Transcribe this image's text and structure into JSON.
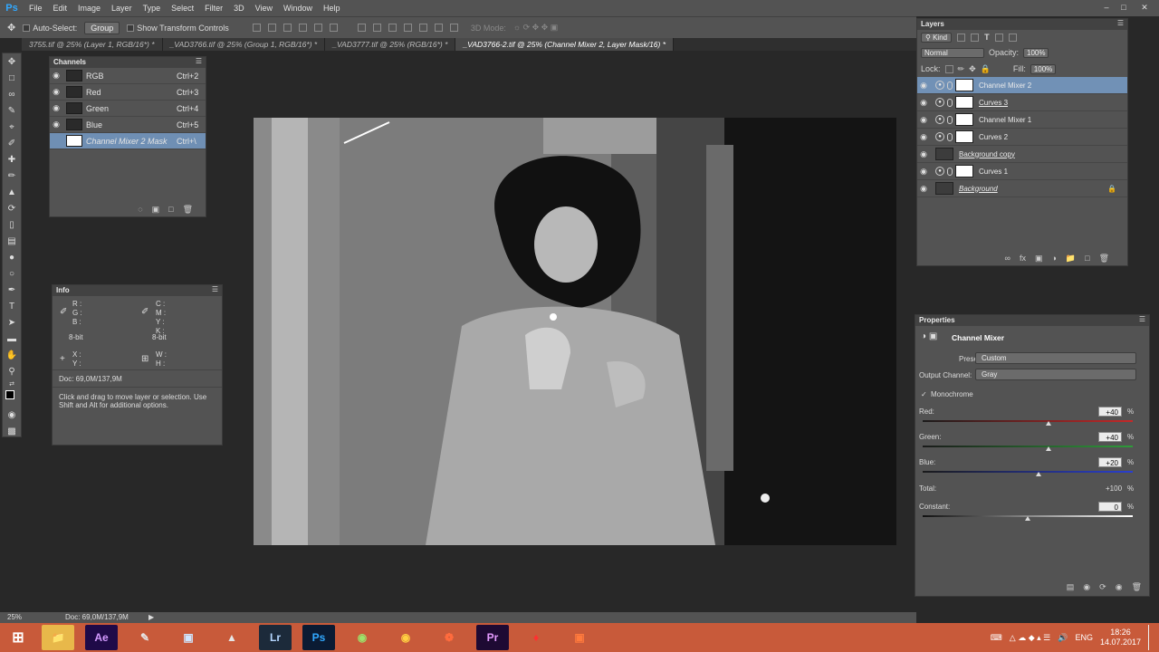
{
  "menubar": {
    "logo": "Ps",
    "items": [
      "File",
      "Edit",
      "Image",
      "Layer",
      "Type",
      "Select",
      "Filter",
      "3D",
      "View",
      "Window",
      "Help"
    ]
  },
  "options": {
    "auto_select_label": "Auto-Select:",
    "auto_select_value": "Group",
    "transform_label": "Show Transform Controls",
    "mode_3d_label": "3D Mode:"
  },
  "tabs": [
    "3755.tif @ 25% (Layer 1, RGB/16*) *",
    "_VAD3766.tif @ 25% (Group 1, RGB/16*) *",
    "_VAD3777.tif @ 25% (RGB/16*) *",
    "_VAD3766-2.tif @ 25% (Channel Mixer 2, Layer Mask/16) *"
  ],
  "channels": {
    "title": "Channels",
    "rows": [
      {
        "name": "RGB",
        "key": "Ctrl+2"
      },
      {
        "name": "Red",
        "key": "Ctrl+3"
      },
      {
        "name": "Green",
        "key": "Ctrl+4"
      },
      {
        "name": "Blue",
        "key": "Ctrl+5"
      },
      {
        "name": "Channel Mixer 2 Mask",
        "key": "Ctrl+\\"
      }
    ]
  },
  "info": {
    "title": "Info",
    "rgb_labels": "R :\nG :\nB :",
    "cmyk_labels": "C :\nM :\nY :\nK :",
    "bit_left": "8-bit",
    "bit_right": "8-bit",
    "xy_labels": "X :\nY :",
    "wh_labels": "W :\nH :",
    "doc": "Doc: 69,0M/137,9M",
    "hint": "Click and drag to move layer or selection.  Use Shift and Alt for additional options."
  },
  "layers": {
    "title": "Layers",
    "kind_label": "Kind",
    "blend_mode": "Normal",
    "opacity_label": "Opacity:",
    "opacity_value": "100%",
    "lock_label": "Lock:",
    "fill_label": "Fill:",
    "fill_value": "100%",
    "rows": [
      {
        "name": "Channel Mixer 2",
        "type": "adjust"
      },
      {
        "name": "Curves 3",
        "type": "adjust"
      },
      {
        "name": "Channel Mixer 1",
        "type": "adjust"
      },
      {
        "name": "Curves 2",
        "type": "adjust"
      },
      {
        "name": "Background copy",
        "type": "image"
      },
      {
        "name": "Curves 1",
        "type": "adjust"
      },
      {
        "name": "Background",
        "type": "image"
      }
    ]
  },
  "properties": {
    "title": "Properties",
    "panel_name": "Channel Mixer",
    "preset_label": "Preset:",
    "preset_value": "Custom",
    "output_label": "Output Channel:",
    "output_value": "Gray",
    "monochrome_label": "Monochrome",
    "red_label": "Red:",
    "red_value": "+40",
    "green_label": "Green:",
    "green_value": "+40",
    "blue_label": "Blue:",
    "blue_value": "+20",
    "total_label": "Total:",
    "total_value": "+100",
    "constant_label": "Constant:",
    "constant_value": "0",
    "pct": "%"
  },
  "status": {
    "zoom": "25%",
    "doc": "Doc: 69,0M/137,9M"
  },
  "taskbar": {
    "apps": [
      "Ae",
      "Lr",
      "Ps",
      "Pr"
    ],
    "lang": "ENG",
    "time": "18:26",
    "date": "14.07.2017"
  }
}
